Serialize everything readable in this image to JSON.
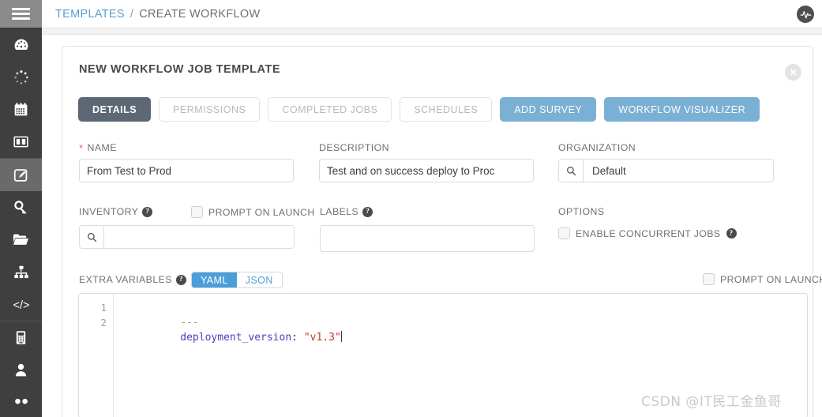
{
  "topbar": {
    "breadcrumb_link": "TEMPLATES",
    "breadcrumb_separator": "/",
    "breadcrumb_current": "CREATE WORKFLOW",
    "logo_name": "ansible-tower-logo"
  },
  "sidebar": {
    "hamburger_name": "menu-toggle",
    "items": [
      {
        "name": "dashboard",
        "icon": "gauge-icon",
        "active": false
      },
      {
        "name": "jobs",
        "icon": "spinner-icon",
        "active": false
      },
      {
        "name": "schedules",
        "icon": "calendar-icon",
        "active": false
      },
      {
        "name": "portal-mode",
        "icon": "columns-icon",
        "active": false
      },
      {
        "name": "templates",
        "icon": "pencil-square-icon",
        "active": true
      },
      {
        "name": "credentials",
        "icon": "key-icon",
        "active": false
      },
      {
        "name": "projects",
        "icon": "folder-icon",
        "active": false
      },
      {
        "name": "inventories",
        "icon": "sitemap-icon",
        "active": false
      },
      {
        "name": "inventory-scripts",
        "icon": "code-icon",
        "active": false
      },
      {
        "name": "settings",
        "icon": "calculator-icon",
        "active": false
      },
      {
        "name": "users",
        "icon": "user-icon",
        "active": false
      }
    ]
  },
  "card": {
    "title": "NEW WORKFLOW JOB TEMPLATE",
    "close_label": "×",
    "tabs": [
      {
        "label": "DETAILS",
        "style": "active"
      },
      {
        "label": "PERMISSIONS",
        "style": "inactive"
      },
      {
        "label": "COMPLETED JOBS",
        "style": "inactive"
      },
      {
        "label": "SCHEDULES",
        "style": "inactive"
      },
      {
        "label": "ADD SURVEY",
        "style": "primary"
      },
      {
        "label": "WORKFLOW VISUALIZER",
        "style": "primary"
      }
    ]
  },
  "form": {
    "name": {
      "label": "NAME",
      "required_marker": "*",
      "value": "From Test to Prod",
      "placeholder": ""
    },
    "description": {
      "label": "DESCRIPTION",
      "value": "Test and on success deploy to Proc",
      "placeholder": ""
    },
    "organization": {
      "label": "ORGANIZATION",
      "value": "Default",
      "placeholder": "",
      "lookup_icon": "search-icon"
    },
    "inventory": {
      "label": "INVENTORY",
      "value": "",
      "placeholder": "",
      "lookup_icon": "search-icon",
      "help_icon": "question-mark-icon",
      "prompt_on_launch_label": "PROMPT ON LAUNCH",
      "prompt_on_launch_checked": false
    },
    "labels": {
      "label": "LABELS",
      "value": "",
      "placeholder": "",
      "help_icon": "question-mark-icon"
    },
    "options": {
      "label": "OPTIONS",
      "enable_concurrent_jobs_label": "ENABLE CONCURRENT JOBS",
      "enable_concurrent_jobs_checked": false,
      "help_icon": "question-mark-icon"
    },
    "extra_variables": {
      "label": "EXTRA VARIABLES",
      "help_icon": "question-mark-icon",
      "format_yaml": "YAML",
      "format_json": "JSON",
      "selected_format": "YAML",
      "prompt_on_launch_label": "PROMPT ON LAUNCH",
      "prompt_on_launch_checked": false,
      "lines": [
        {
          "number": "1",
          "dash": "---",
          "key": "",
          "colon": "",
          "value": ""
        },
        {
          "number": "2",
          "dash": "",
          "key": "deployment_version",
          "colon": ": ",
          "value": "\"v1.3\""
        }
      ]
    }
  },
  "colors": {
    "accent_blue": "#4c9ed9",
    "button_blue": "#7ab0d4",
    "tab_active_gray": "#5c6873",
    "sidebar_dark": "#3f3f3f",
    "sidebar_active": "#6a6a6a",
    "required_red": "#e06c5c",
    "string_red": "#c0392b",
    "key_purple": "#4a3fbd",
    "breadcrumb_link": "#5c9ccc"
  },
  "watermark": {
    "text": "CSDN @IT民工金鱼哥"
  }
}
